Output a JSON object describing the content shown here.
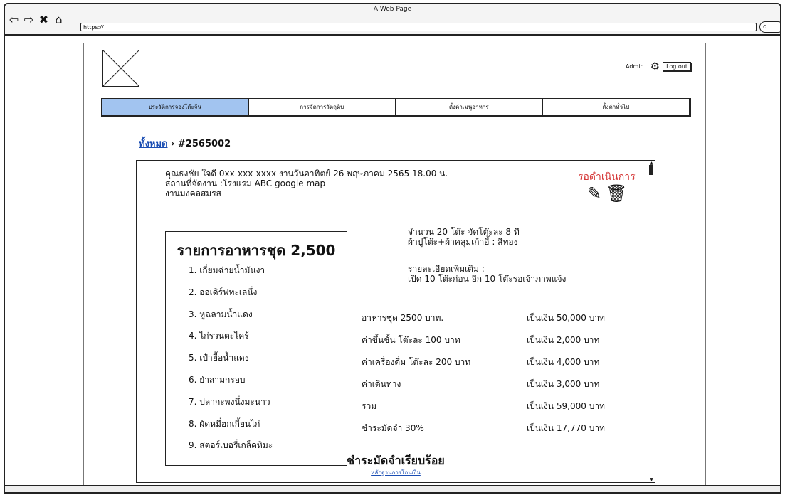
{
  "window": {
    "title": "A Web Page",
    "url": "https://",
    "search_label": "q"
  },
  "icons": {
    "back": "left-arrow-icon",
    "forward": "right-arrow-icon",
    "close": "x-icon",
    "home": "home-icon"
  },
  "header": {
    "admin_label": ".Admin..",
    "logout_label": "Log out"
  },
  "tabs": [
    {
      "label": "ประวัติการจองโต๊ะจีน",
      "active": true
    },
    {
      "label": "การจัดการวัตถุดิบ",
      "active": false
    },
    {
      "label": "ตั้งค่าเมนูอาหาร",
      "active": false
    },
    {
      "label": "ตั้งค่าทั่วไป",
      "active": false
    }
  ],
  "breadcrumb": {
    "root": "ทั้งหมด",
    "separator": "›",
    "current": "#2565002"
  },
  "booking": {
    "line1": "คุณธงชัย ใจดี 0xx-xxx-xxxx งานวันอาทิตย์ 26 พฤษภาคม 2565 18.00 น.",
    "line2": "สถานที่จัดงาน :โรงแรม ABC google map",
    "line3": "งานมงคลสมรส",
    "status": "รอดำเนินการ",
    "status_color": "#d63b3b"
  },
  "menu": {
    "title": "รายการอาหารชุด 2,500",
    "items": [
      "1. เกี๋ยมฉ่ายน้ำมันงา",
      "2. ออเดิร์ฟทะเลนึ่ง",
      "3. หูฉลามน้ำแดง",
      "4. ไก่รวนตะไคร้",
      "5. เป๋าฮื้อน้ำแดง",
      "6. ยำสามกรอบ",
      "7. ปลากะพงนึ่งมะนาว",
      "8. ผัดหมี่ฮกเกี้ยนไก่",
      "9. สตอร์เบอรี่เกล็ดหิมะ"
    ]
  },
  "tables": {
    "line1": "จำนวน 20 โต๊ะ จัดโต๊ะละ 8 ที",
    "line2": "ผ้าปูโต๊ะ+ผ้าคลุมเก้าอี้ : สีทอง"
  },
  "extra": {
    "line1": "รายละเอียดเพิ่มเติม :",
    "line2": "เปิด 10 โต๊ะก่อน อีก 10 โต๊ะรอเจ้าภาพแจ้ง"
  },
  "costs": [
    {
      "label": "อาหารชุด 2500 บาท.",
      "amount": "เป็นเงิน 50,000 บาท"
    },
    {
      "label": "ค่าขึ้นชั้น โต๊ะละ 100 บาท",
      "amount": "เป็นเงิน 2,000 บาท"
    },
    {
      "label": "ค่าเครื่องดื่ม โต๊ะละ 200 บาท",
      "amount": "เป็นเงิน 4,000 บาท"
    },
    {
      "label": "ค่าเดินทาง",
      "amount": "เป็นเงิน 3,000 บาท"
    },
    {
      "label": "รวม",
      "amount": "เป็นเงิน 59,000 บาท"
    },
    {
      "label": "ชำระมัดจำ 30%",
      "amount": "เป็นเงิน 17,770 บาท"
    }
  ],
  "payment": {
    "status": "ชำระมัดจำเรียบร้อย",
    "proof_link": "หลักฐานการโอนเงิน"
  }
}
